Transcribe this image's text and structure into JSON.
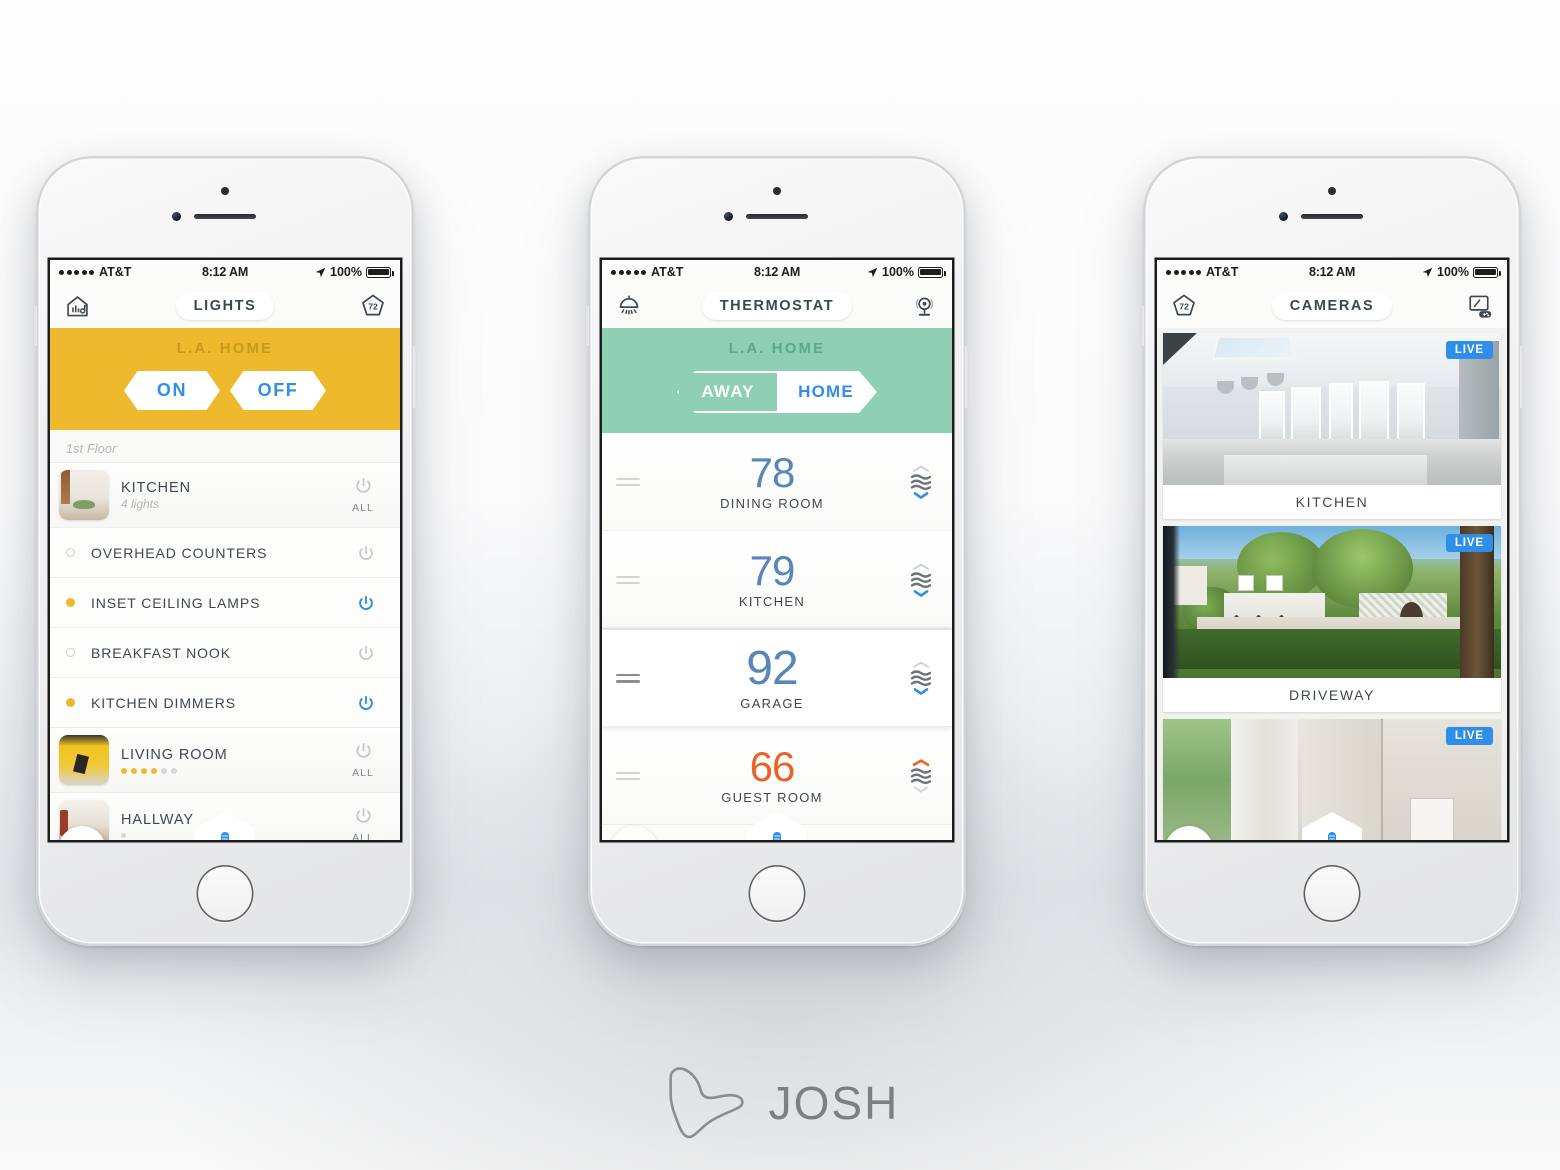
{
  "brand": {
    "name": "JOSH",
    "logo_icon": "josh-dog-logo"
  },
  "status_bar": {
    "carrier": "AT&T",
    "time": "8:12 AM",
    "battery": "100%",
    "signal_dots": 5
  },
  "phones": [
    {
      "id": "lights",
      "nav": {
        "title": "LIGHTS",
        "left_icon": "home-music-icon",
        "right_icon": "thermostat-pentagon-icon",
        "right_icon_value": "72"
      },
      "scene": {
        "title": "L.A. HOME",
        "on_label": "ON",
        "off_label": "OFF",
        "color": "#eeb92c"
      },
      "floor_label": "1st Floor",
      "rooms": [
        {
          "name": "KITCHEN",
          "sub": "4 lights",
          "all_label": "ALL",
          "power_state": "off",
          "thumb": "kitchen",
          "bulbs": [
            {
              "name": "OVERHEAD COUNTERS",
              "state": "off"
            },
            {
              "name": "INSET CEILING LAMPS",
              "state": "on"
            },
            {
              "name": "BREAKFAST NOOK",
              "state": "off"
            },
            {
              "name": "KITCHEN DIMMERS",
              "state": "on"
            }
          ]
        },
        {
          "name": "LIVING ROOM",
          "sub": "",
          "all_label": "ALL",
          "power_state": "off",
          "thumb": "living",
          "dim_level": 4,
          "dim_total": 6,
          "bulbs": []
        },
        {
          "name": "HALLWAY",
          "sub": "",
          "all_label": "ALL",
          "power_state": "off",
          "thumb": "hallway",
          "dim_level": 0,
          "dim_total": 1,
          "bulbs": []
        }
      ],
      "bottom": {
        "scene_icon": "sunburst-scene-icon",
        "mic_icon": "microphone-icon"
      }
    },
    {
      "id": "thermostat",
      "nav": {
        "title": "THERMOSTAT",
        "left_icon": "ceiling-lamp-icon",
        "right_icon": "security-camera-icon"
      },
      "scene": {
        "title": "L.A. HOME",
        "away_label": "AWAY",
        "home_label": "HOME",
        "selected": "HOME",
        "color": "#8fd0b4"
      },
      "zones": [
        {
          "room": "DINING ROOM",
          "temp": "78",
          "mode": "cool",
          "arrow": "down",
          "lifted": false
        },
        {
          "room": "KITCHEN",
          "temp": "79",
          "mode": "cool",
          "arrow": "down",
          "lifted": false
        },
        {
          "room": "GARAGE",
          "temp": "92",
          "mode": "cool",
          "arrow": "down",
          "lifted": true
        },
        {
          "room": "GUEST ROOM",
          "temp": "66",
          "mode": "heat",
          "arrow": "up",
          "lifted": false
        }
      ],
      "bottom": {
        "scene_icon": "sunburst-scene-icon",
        "mic_icon": "microphone-icon"
      }
    },
    {
      "id": "cameras",
      "nav": {
        "title": "CAMERAS",
        "left_icon": "thermostat-pentagon-icon",
        "left_icon_value": "72",
        "right_icon": "media-entertainment-icon"
      },
      "feeds": [
        {
          "label": "KITCHEN",
          "badge": "LIVE",
          "scene": "kitchen"
        },
        {
          "label": "DRIVEWAY",
          "badge": "LIVE",
          "scene": "driveway"
        },
        {
          "label": "",
          "badge": "LIVE",
          "scene": "room"
        }
      ],
      "bottom": {
        "scene_icon": "sunburst-scene-icon",
        "mic_icon": "microphone-icon"
      }
    }
  ],
  "colors": {
    "accent_blue": "#2f8fe8",
    "lights_yellow": "#eeb92c",
    "thermo_green": "#8fd0b4",
    "cool_blue": "#5886b8",
    "heat_orange": "#e8632a",
    "text_dark": "#3f4750"
  }
}
